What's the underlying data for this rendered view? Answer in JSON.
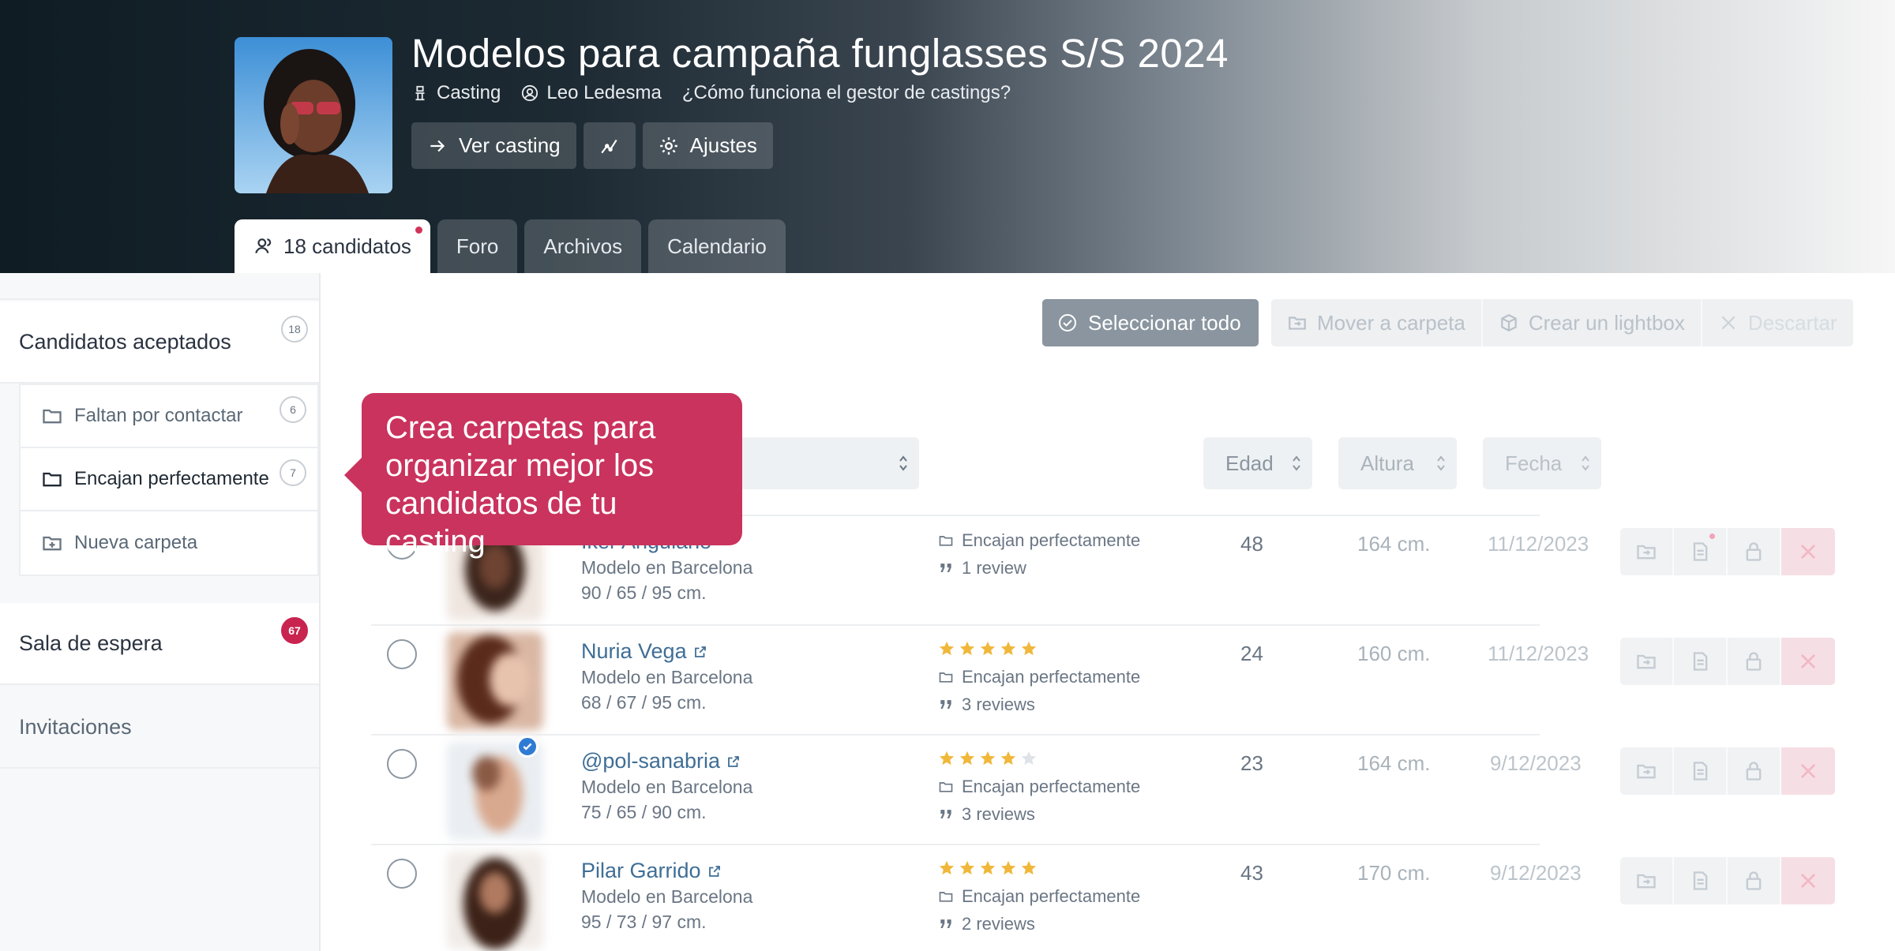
{
  "header": {
    "title": "Modelos para campaña funglasses S/S 2024",
    "type_label": "Casting",
    "owner": "Leo Ledesma",
    "help_link": "¿Cómo funciona el gestor de castings?",
    "buttons": {
      "view": "Ver casting",
      "settings": "Ajustes"
    }
  },
  "tabs": [
    {
      "label": "18 candidatos",
      "active": true,
      "notification": true
    },
    {
      "label": "Foro"
    },
    {
      "label": "Archivos"
    },
    {
      "label": "Calendario"
    }
  ],
  "sidebar": {
    "accepted": {
      "label": "Candidatos aceptados",
      "count": "18"
    },
    "folders": [
      {
        "label": "Faltan por contactar",
        "count": "6"
      },
      {
        "label": "Encajan perfectamente",
        "count": "7",
        "active": true
      },
      {
        "label": "Nueva carpeta"
      }
    ],
    "waiting": {
      "label": "Sala de espera",
      "count": "67"
    },
    "invitations": {
      "label": "Invitaciones"
    }
  },
  "toolbar": {
    "select_all": "Seleccionar todo",
    "move": "Mover a carpeta",
    "lightbox": "Crear un lightbox",
    "discard": "Descartar"
  },
  "columns": {
    "age": "Edad",
    "height": "Altura",
    "date": "Fecha"
  },
  "tooltip": {
    "text": "Crea carpetas para organizar mejor los candidatos de tu casting"
  },
  "candidates": [
    {
      "name": "Iker Angulano",
      "role": "Modelo en Barcelona",
      "measures": "90 / 65 / 95 cm.",
      "rating": 0,
      "folder": "Encajan perfectamente",
      "reviews": "1 review",
      "age": "48",
      "height": "164 cm.",
      "date": "11/12/2023"
    },
    {
      "name": "Nuria Vega",
      "role": "Modelo en Barcelona",
      "measures": "68 / 67 / 95 cm.",
      "rating": 5,
      "folder": "Encajan perfectamente",
      "reviews": "3 reviews",
      "age": "24",
      "height": "160 cm.",
      "date": "11/12/2023"
    },
    {
      "name": "@pol-sanabria",
      "role": "Modelo en Barcelona",
      "measures": "75 / 65 / 90 cm.",
      "rating": 4,
      "folder": "Encajan perfectamente",
      "reviews": "3 reviews",
      "age": "23",
      "height": "164 cm.",
      "date": "9/12/2023",
      "verified": true
    },
    {
      "name": "Pilar Garrido",
      "role": "Modelo en Barcelona",
      "measures": "95 / 73 / 97 cm.",
      "rating": 5,
      "folder": "Encajan perfectamente",
      "reviews": "2 reviews",
      "age": "43",
      "height": "170 cm.",
      "date": "9/12/2023"
    }
  ],
  "colors": {
    "accent": "#c9335d",
    "link": "#3f6e96",
    "star": "#f0b73a"
  }
}
